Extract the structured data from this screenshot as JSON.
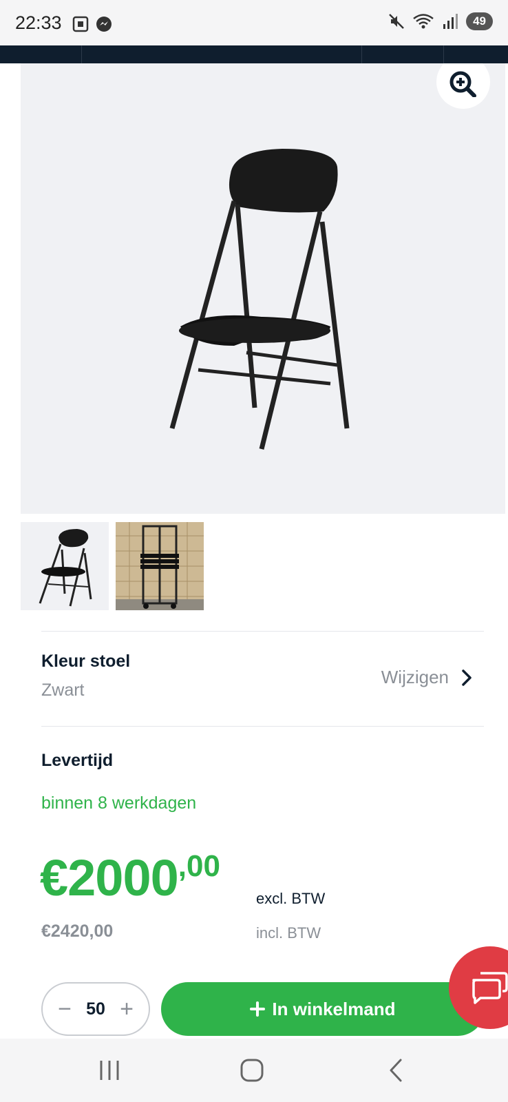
{
  "status_bar": {
    "time": "22:33",
    "battery": "49"
  },
  "product": {
    "color_label": "Kleur stoel",
    "color_value": "Zwart",
    "change_label": "Wijzigen",
    "delivery_label": "Levertijd",
    "delivery_value": "binnen 8 werkdagen",
    "price_int": "€2000",
    "price_dec": ",00",
    "excl_label": "excl. BTW",
    "price_incl": "€2420,00",
    "incl_label": "incl. BTW"
  },
  "cart": {
    "quantity": "50",
    "button_label": "In winkelmand"
  },
  "colors": {
    "accent_green": "#2fb34a",
    "navy": "#0f1e2e",
    "chat_red": "#e03c44"
  }
}
